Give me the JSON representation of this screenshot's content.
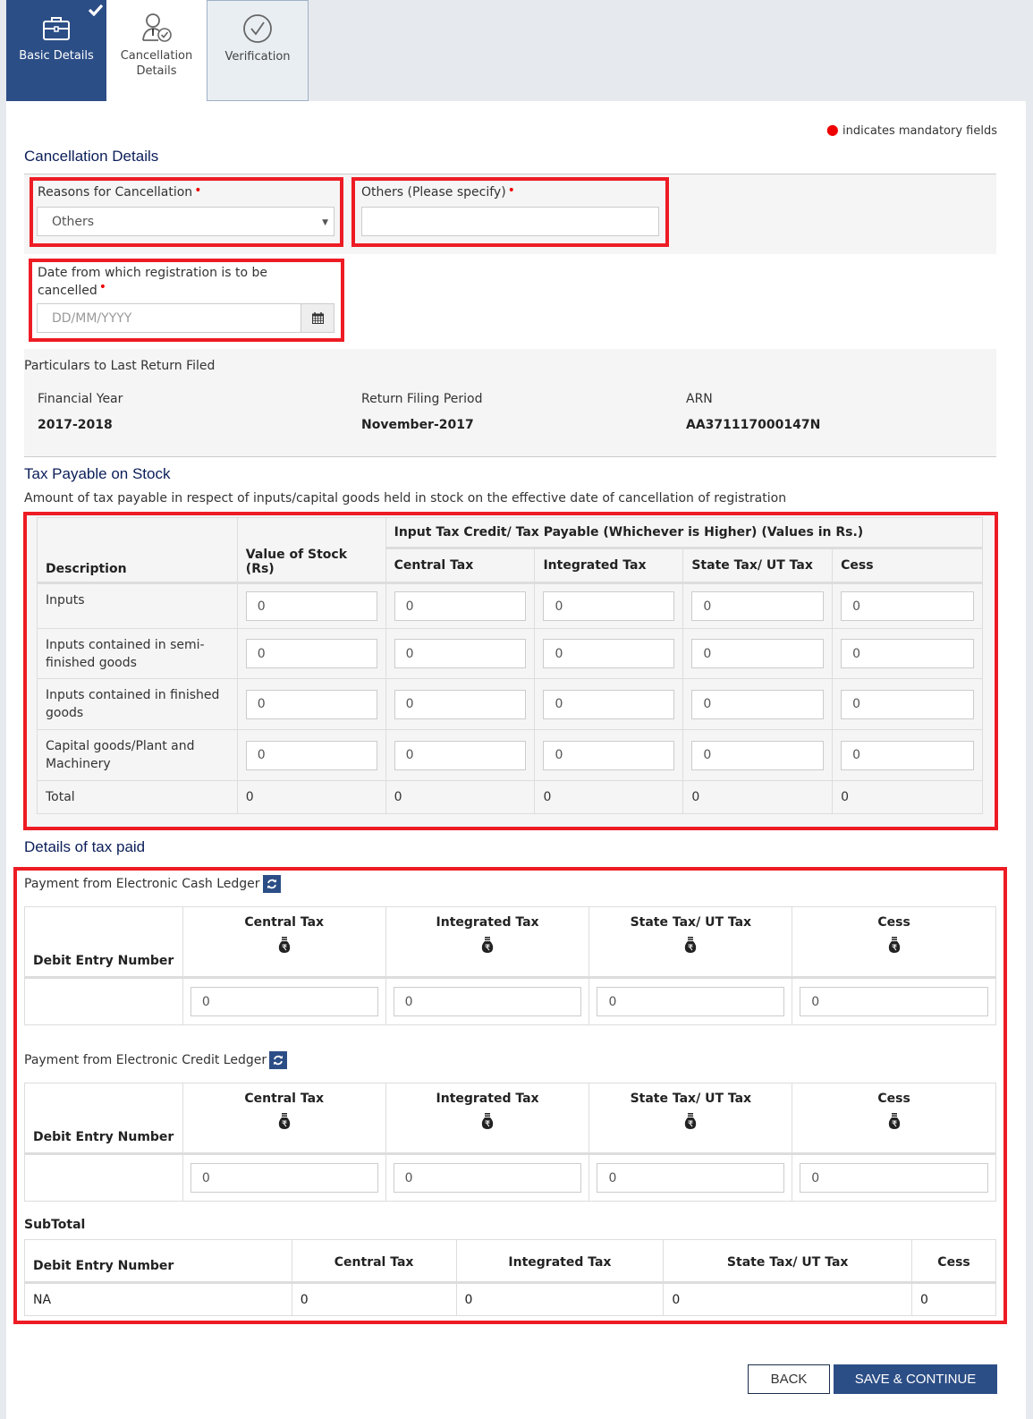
{
  "tabs": [
    {
      "label": "Basic Details",
      "state": "completed",
      "icon": "briefcase-icon"
    },
    {
      "label": "Cancellation Details",
      "state": "current",
      "icon": "user-check-icon"
    },
    {
      "label": "Verification",
      "state": "pending",
      "icon": "check-circle-icon"
    }
  ],
  "mandatory_note": "indicates mandatory fields",
  "cancellation": {
    "heading": "Cancellation Details",
    "reason_label": "Reasons for Cancellation",
    "reason_value": "Others",
    "others_label": "Others (Please specify)",
    "others_value": "",
    "date_label": "Date from which registration is to be cancelled",
    "date_placeholder": "DD/MM/YYYY"
  },
  "last_return": {
    "heading": "Particulars to Last Return Filed",
    "fy_label": "Financial Year",
    "fy_value": "2017-2018",
    "period_label": "Return Filing Period",
    "period_value": "November-2017",
    "arn_label": "ARN",
    "arn_value": "AA371117000147N"
  },
  "stock": {
    "heading": "Tax Payable on Stock",
    "description": "Amount of tax payable in respect of inputs/capital goods held in stock on the effective date of cancellation of registration",
    "col_description": "Description",
    "col_value": "Value of Stock (Rs)",
    "group_header": "Input Tax Credit/ Tax Payable (Whichever is Higher) (Values in Rs.)",
    "cols": [
      "Central Tax",
      "Integrated Tax",
      "State Tax/ UT Tax",
      "Cess"
    ],
    "rows": [
      {
        "label": "Inputs",
        "values": [
          "0",
          "0",
          "0",
          "0",
          "0"
        ]
      },
      {
        "label": "Inputs contained in semi-finished goods",
        "values": [
          "0",
          "0",
          "0",
          "0",
          "0"
        ]
      },
      {
        "label": "Inputs contained in finished goods",
        "values": [
          "0",
          "0",
          "0",
          "0",
          "0"
        ]
      },
      {
        "label": "Capital goods/Plant and Machinery",
        "values": [
          "0",
          "0",
          "0",
          "0",
          "0"
        ]
      }
    ],
    "total": {
      "label": "Total",
      "values": [
        "0",
        "0",
        "0",
        "0",
        "0"
      ]
    }
  },
  "tax_paid": {
    "heading": "Details of tax paid",
    "cash": {
      "label": "Payment from Electronic Cash Ledger",
      "col_debit": "Debit Entry Number",
      "cols": [
        "Central Tax",
        "Integrated Tax",
        "State Tax/ UT Tax",
        "Cess"
      ],
      "debit_value": "",
      "values": [
        "0",
        "0",
        "0",
        "0"
      ]
    },
    "credit": {
      "label": "Payment from Electronic Credit Ledger",
      "col_debit": "Debit Entry Number",
      "cols": [
        "Central Tax",
        "Integrated Tax",
        "State Tax/ UT Tax",
        "Cess"
      ],
      "debit_value": "",
      "values": [
        "0",
        "0",
        "0",
        "0"
      ]
    },
    "subtotal": {
      "label": "SubTotal",
      "col_debit": "Debit Entry Number",
      "cols": [
        "Central Tax",
        "Integrated Tax",
        "State Tax/ UT Tax",
        "Cess"
      ],
      "debit_value": "NA",
      "values": [
        "0",
        "0",
        "0",
        "0"
      ]
    }
  },
  "buttons": {
    "back": "BACK",
    "save": "SAVE & CONTINUE"
  },
  "colors": {
    "brand": "#2c4e86",
    "highlight": "#ed1c24",
    "required": "#e00000",
    "heading": "#0b1e59"
  }
}
